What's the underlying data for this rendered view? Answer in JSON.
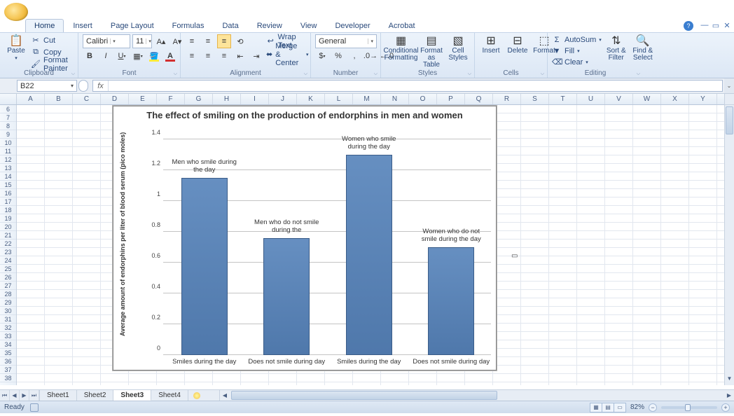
{
  "tabs": [
    "Home",
    "Insert",
    "Page Layout",
    "Formulas",
    "Data",
    "Review",
    "View",
    "Developer",
    "Acrobat"
  ],
  "active_tab": 0,
  "ribbon": {
    "clipboard": {
      "title": "Clipboard",
      "paste": "Paste",
      "cut": "Cut",
      "copy": "Copy",
      "format_painter": "Format Painter"
    },
    "font": {
      "title": "Font",
      "name": "Calibri",
      "size": "11"
    },
    "alignment": {
      "title": "Alignment",
      "wrap": "Wrap Text",
      "merge": "Merge & Center"
    },
    "number": {
      "title": "Number",
      "format": "General"
    },
    "styles": {
      "title": "Styles",
      "cond": "Conditional Formatting",
      "table": "Format as Table",
      "cell": "Cell Styles"
    },
    "cells": {
      "title": "Cells",
      "insert": "Insert",
      "delete": "Delete",
      "format": "Format"
    },
    "editing": {
      "title": "Editing",
      "autosum": "AutoSum",
      "fill": "Fill",
      "clear": "Clear",
      "sort": "Sort & Filter",
      "find": "Find & Select"
    }
  },
  "name_box": "B22",
  "formula_bar": "",
  "columns": [
    "A",
    "B",
    "C",
    "D",
    "E",
    "F",
    "G",
    "H",
    "I",
    "J",
    "K",
    "L",
    "M",
    "N",
    "O",
    "P",
    "Q",
    "R",
    "S",
    "T",
    "U",
    "V",
    "W",
    "X",
    "Y"
  ],
  "row_start": 6,
  "row_end": 38,
  "sheets": [
    "Sheet1",
    "Sheet2",
    "Sheet3",
    "Sheet4"
  ],
  "active_sheet": 2,
  "status_text": "Ready",
  "zoom": "82%",
  "chart_data": {
    "type": "bar",
    "title": "The effect of smiling on the production of endorphins in men and women",
    "ylabel": "Average amount of endorphins per liter of blood serum (pico moles)",
    "ylim": [
      0,
      1.4
    ],
    "yticks": [
      0,
      0.2,
      0.4,
      0.6,
      0.8,
      1,
      1.2,
      1.4
    ],
    "categories": [
      "Smiles during the day",
      "Does not smile during day",
      "Smiles during the day",
      "Does not smile during day"
    ],
    "values": [
      1.15,
      0.76,
      1.3,
      0.7
    ],
    "data_labels": [
      "Men who smile during the day",
      "Men who do not smile during the",
      "Women who smile during the day",
      "Women who do not smile during the day"
    ]
  }
}
